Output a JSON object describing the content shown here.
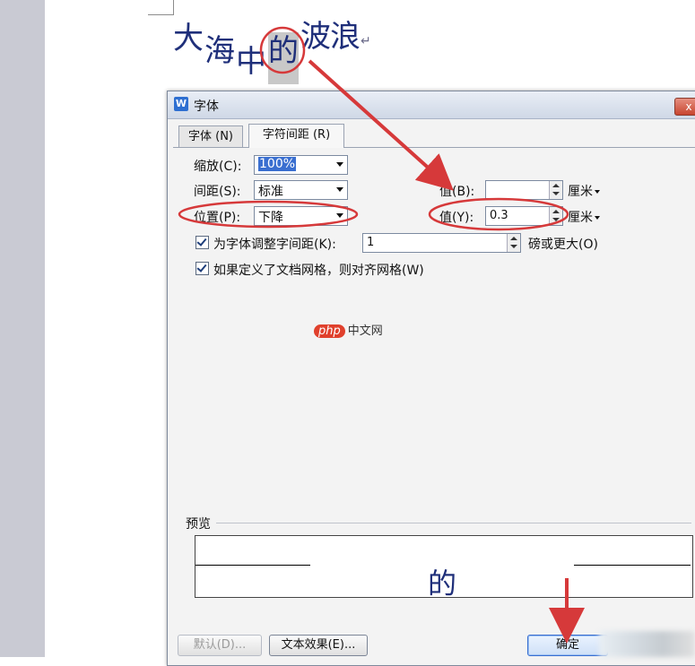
{
  "document": {
    "text_chars": [
      "大",
      "海",
      "中",
      "的",
      "波",
      "浪"
    ],
    "paragraph_mark": "↵"
  },
  "dialog": {
    "title": "字体",
    "close_label": "x",
    "tabs": [
      {
        "label": "字体 (N)",
        "active": false
      },
      {
        "label": "字符间距 (R)",
        "active": true
      }
    ],
    "scale": {
      "label": "缩放(C):",
      "value": "100%"
    },
    "spacing": {
      "label": "间距(S):",
      "value": "标准",
      "amount_label": "值(B):",
      "amount_value": "",
      "unit": "厘米"
    },
    "position": {
      "label": "位置(P):",
      "value": "下降",
      "amount_label": "值(Y):",
      "amount_value": "0.3",
      "unit": "厘米"
    },
    "kerning": {
      "label": "为字体调整字间距(K):",
      "value": "1",
      "suffix": "磅或更大(O)",
      "checked": true
    },
    "grid": {
      "label": "如果定义了文档网格，则对齐网格(W)",
      "checked": true
    },
    "preview": {
      "label": "预览",
      "sample": "的"
    },
    "buttons": {
      "default": "默认(D)...",
      "text_effects": "文本效果(E)...",
      "ok": "确定"
    }
  },
  "watermark": {
    "brand": "php",
    "text": "中文网"
  },
  "colors": {
    "annotation_red": "#d6393a",
    "doc_text": "#1f2f7a",
    "selection": "#3a6fd0"
  }
}
